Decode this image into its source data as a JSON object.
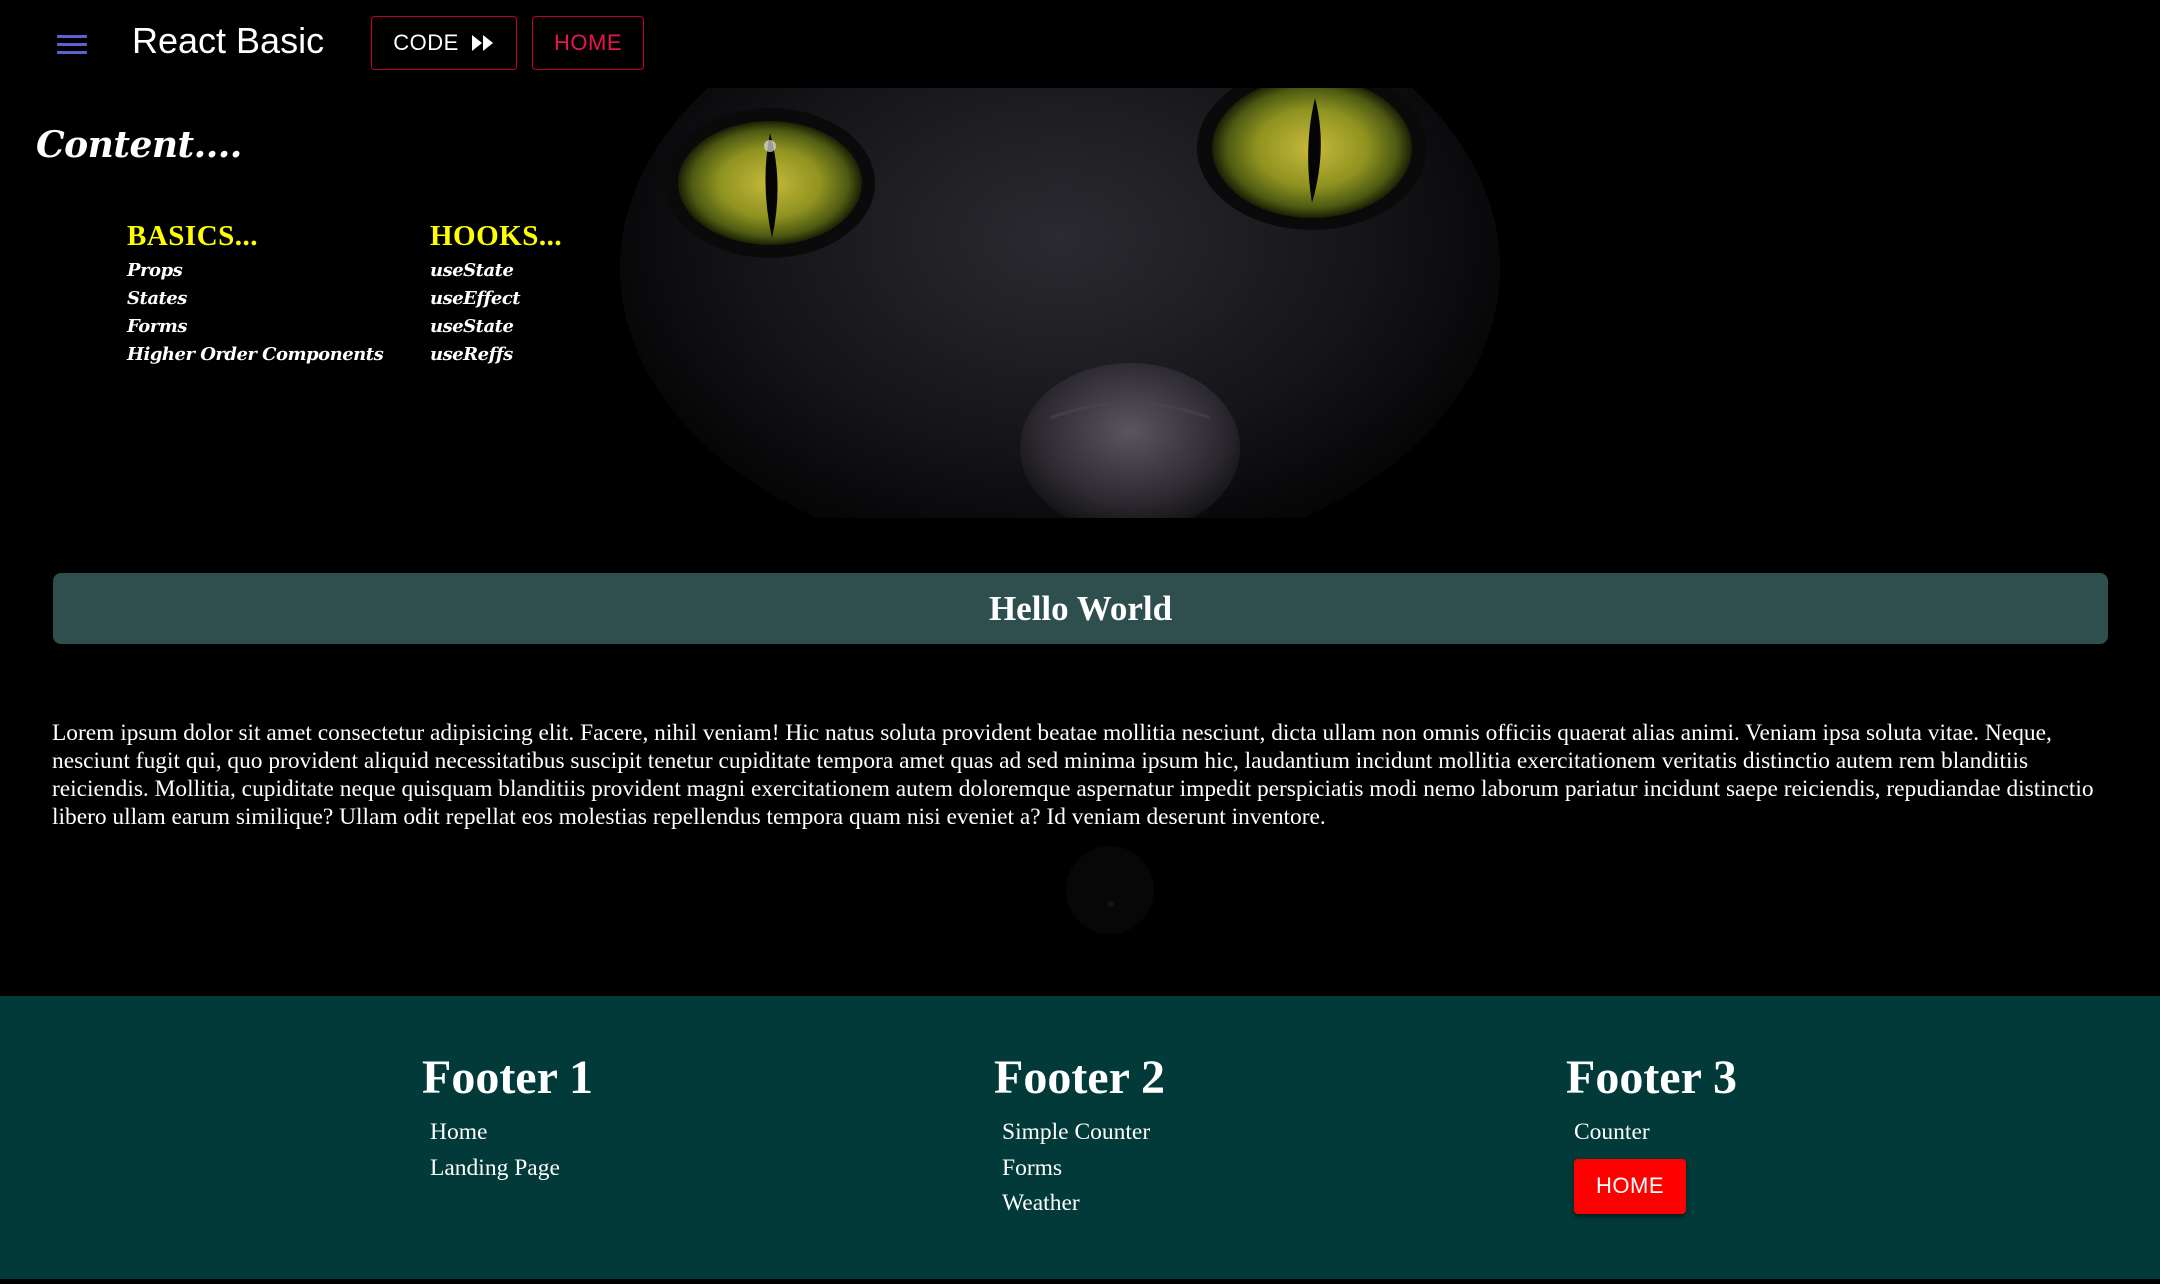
{
  "appbar": {
    "menu_icon": "hamburger-menu-icon",
    "title": "React Basic",
    "code_button": "CODE",
    "code_icon": "fast-forward-icon",
    "home_button": "HOME",
    "accent_color": "#c2002f",
    "menu_color": "#5b61d6"
  },
  "hero": {
    "image": "black-cat-green-eyes",
    "content_title": "Content....",
    "basics": {
      "heading": "BASICS...",
      "items": [
        "Props",
        "States",
        "Forms",
        "Higher Order Components"
      ]
    },
    "hooks": {
      "heading": "HOOKS...",
      "items": [
        "useState",
        "useEffect",
        "useState",
        "useReffs"
      ]
    },
    "heading_color": "#ffff00"
  },
  "main": {
    "banner": "Hello World",
    "banner_color": "#2f4f4f",
    "paragraph": "Lorem ipsum dolor sit amet consectetur adipisicing elit. Facere, nihil veniam! Hic natus soluta provident beatae mollitia nesciunt, dicta ullam non omnis officiis quaerat alias animi. Veniam ipsa soluta vitae. Neque, nesciunt fugit qui, quo provident aliquid necessitatibus suscipit tenetur cupiditate tempora amet quas ad sed minima ipsum hic, laudantium incidunt mollitia exercitationem veritatis distinctio autem rem blanditiis reiciendis. Mollitia, cupiditate neque quisquam blanditiis provident magni exercitationem autem doloremque aspernatur impedit perspiciatis modi nemo laborum pariatur incidunt saepe reiciendis, repudiandae distinctio libero ullam earum similique? Ullam odit repellat eos molestias repellendus tempora quam nisi eveniet a? Id veniam deserunt inventore."
  },
  "footer": {
    "background": "#013a38",
    "col1": {
      "title": "Footer 1",
      "links": [
        "Home",
        "Landing Page"
      ]
    },
    "col2": {
      "title": "Footer 2",
      "links": [
        "Simple Counter",
        "Forms",
        "Weather"
      ]
    },
    "col3": {
      "title": "Footer 3",
      "links": [
        "Counter"
      ],
      "button": "HOME",
      "button_color": "#ff0000"
    }
  }
}
